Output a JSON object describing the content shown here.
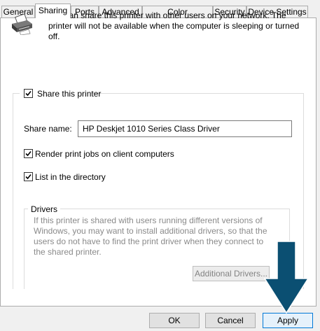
{
  "tabs": [
    {
      "label": "General"
    },
    {
      "label": "Sharing"
    },
    {
      "label": "Ports"
    },
    {
      "label": "Advanced"
    },
    {
      "label": "Color Management"
    },
    {
      "label": "Security"
    },
    {
      "label": "Device Settings"
    }
  ],
  "active_tab": "Sharing",
  "info": {
    "text": "You can share this printer with other users on your network. The printer will not be available when the computer is sleeping or turned off.",
    "icon": "printer-icon"
  },
  "share": {
    "share_this_printer_label": "Share this printer",
    "share_this_printer_checked": true,
    "share_name_label": "Share name:",
    "share_name_value": "HP Deskjet 1010 Series Class Driver",
    "render_label": "Render print jobs on client computers",
    "render_checked": true,
    "list_label": "List in the directory",
    "list_checked": true
  },
  "drivers": {
    "title": "Drivers",
    "text": "If this printer is shared with users running different versions of Windows, you may want to install additional drivers, so that the users do not have to find the print driver when they connect to the shared printer.",
    "additional_drivers_label": "Additional Drivers..."
  },
  "buttons": {
    "ok": "OK",
    "cancel": "Cancel",
    "apply": "Apply"
  },
  "colors": {
    "arrow": "#0b4f72",
    "accent": "#0078d7"
  }
}
